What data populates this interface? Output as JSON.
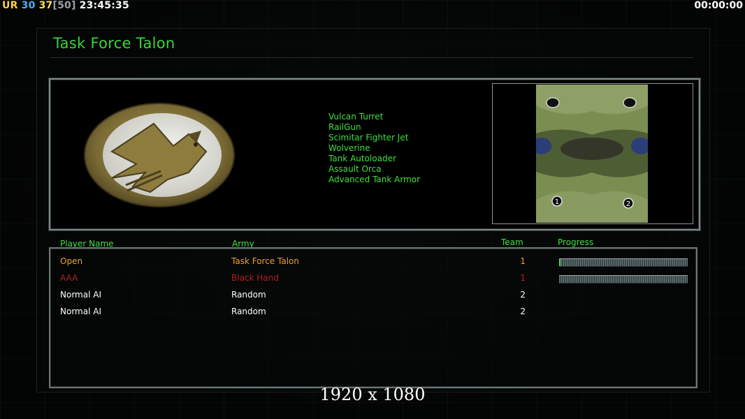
{
  "overlay": {
    "ur_label": "UR",
    "fps": "30",
    "units_current": "37",
    "units_max": "[50]",
    "clock": "23:45:35",
    "timer": "00:00:00"
  },
  "title": "Task Force Talon",
  "emblem_icon": "eagle-emblem-icon",
  "upgrades": [
    "Vulcan Turret",
    "RailGun",
    "Scimitar Fighter Jet",
    "Wolverine",
    "Tank Autoloader",
    "Assault Orca",
    "Advanced Tank Armor"
  ],
  "map": {
    "start_labels": [
      "1",
      "2"
    ]
  },
  "columns": {
    "player": "Player Name",
    "army": "Army",
    "team": "Team",
    "progress": "Progress"
  },
  "players": [
    {
      "name": "Open",
      "army": "Task Force Talon",
      "team": "1",
      "color": "#f0a02a",
      "progress": 0.01
    },
    {
      "name": "AAA",
      "army": "Black Hand",
      "team": "1",
      "color": "#b0201c",
      "progress": 0.0
    },
    {
      "name": "Normal AI",
      "army": "Random",
      "team": "2",
      "color": "#ffffff"
    },
    {
      "name": "Normal AI",
      "army": "Random",
      "team": "2",
      "color": "#ffffff"
    }
  ],
  "resolution": "1920 x 1080",
  "colors": {
    "accent_green": "#3ee03e",
    "open_orange": "#f0a02a",
    "enemy_red": "#b0201c"
  }
}
